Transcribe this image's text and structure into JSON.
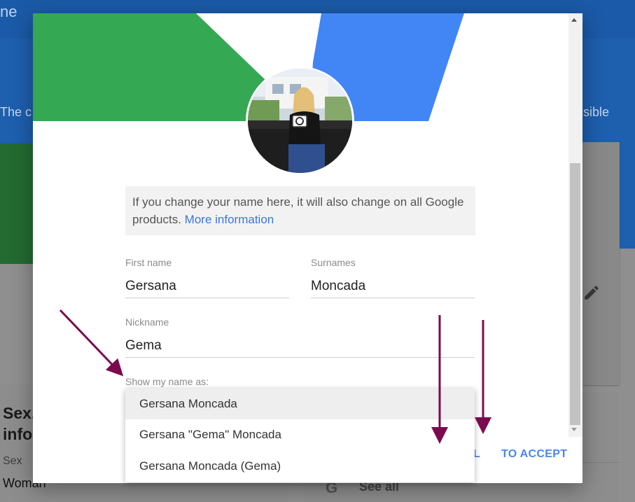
{
  "background": {
    "title_fragment": "ne",
    "text_left_fragment": "The c",
    "text_right_fragment": "sible",
    "sex_section_title": "Sex, info",
    "sex_label": "Sex",
    "sex_value": "Woman",
    "see_all_label": "See all",
    "google_letter": "G"
  },
  "dialog": {
    "info_text": "If you change your name here, it will also change on all Google products.",
    "info_link": "More information",
    "first_name_label": "First name",
    "first_name_value": "Gersana",
    "surnames_label": "Surnames",
    "surnames_value": "Moncada",
    "nickname_label": "Nickname",
    "nickname_value": "Gema",
    "show_name_label": "Show my name as:",
    "cancel_fragment": "L",
    "accept_label": "TO ACCEPT"
  },
  "display_name_options": [
    "Gersana Moncada",
    "Gersana \"Gema\" Moncada",
    "Gersana Moncada (Gema)"
  ],
  "selected_option_index": 0,
  "colors": {
    "green": "#34a853",
    "blue": "#4285f4",
    "accent": "#4a86e8",
    "annotation": "#7b0a4f"
  }
}
